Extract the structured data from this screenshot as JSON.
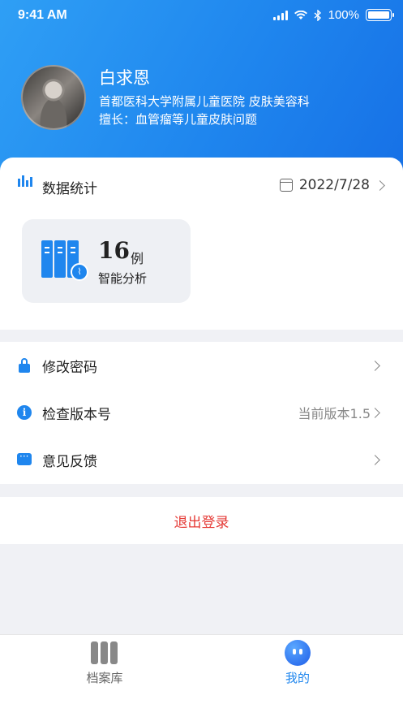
{
  "status_bar": {
    "time": "9:41 AM",
    "battery": "100%"
  },
  "profile": {
    "name": "白求恩",
    "hospital": "首都医科大学附属儿童医院  皮肤美容科",
    "specialty": "擅长：血管瘤等儿童皮肤问题"
  },
  "stats": {
    "title": "数据统计",
    "date": "2022/7/28",
    "count": "16",
    "unit": "例",
    "label": "智能分析"
  },
  "menu": {
    "items": [
      {
        "label": "修改密码",
        "icon": "lock-icon",
        "value": ""
      },
      {
        "label": "检查版本号",
        "icon": "info-icon",
        "value": "当前版本1.5"
      },
      {
        "label": "意见反馈",
        "icon": "message-icon",
        "value": ""
      }
    ]
  },
  "logout_label": "退出登录",
  "tabbar": {
    "tabs": [
      {
        "label": "档案库",
        "icon": "archive-icon",
        "active": false
      },
      {
        "label": "我的",
        "icon": "profile-icon",
        "active": true
      }
    ]
  },
  "colors": {
    "primary": "#1f86ee",
    "danger": "#e53935",
    "background": "#f0f1f5"
  }
}
